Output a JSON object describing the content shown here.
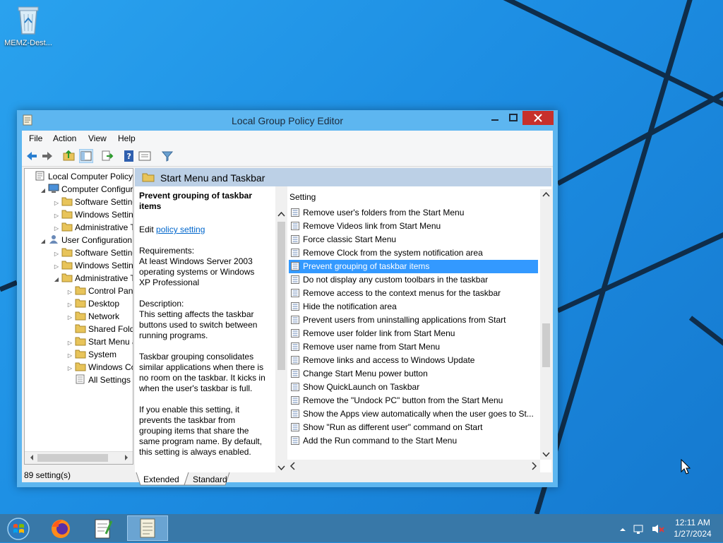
{
  "desktop": {
    "recycle_label": "MEMZ-Dest..."
  },
  "window": {
    "title": "Local Group Policy Editor",
    "menu": [
      "File",
      "Action",
      "View",
      "Help"
    ]
  },
  "tree": [
    {
      "label": "Local Computer Policy",
      "level": 0,
      "exp": ""
    },
    {
      "label": "Computer Configura",
      "level": 1,
      "exp": "open"
    },
    {
      "label": "Software Settings",
      "level": 2,
      "exp": "closed"
    },
    {
      "label": "Windows Setting",
      "level": 2,
      "exp": "closed"
    },
    {
      "label": "Administrative Te",
      "level": 2,
      "exp": "closed"
    },
    {
      "label": "User Configuration",
      "level": 1,
      "exp": "open"
    },
    {
      "label": "Software Settings",
      "level": 2,
      "exp": "closed"
    },
    {
      "label": "Windows Setting",
      "level": 2,
      "exp": "closed"
    },
    {
      "label": "Administrative Te",
      "level": 2,
      "exp": "open"
    },
    {
      "label": "Control Panel",
      "level": 3,
      "exp": "closed"
    },
    {
      "label": "Desktop",
      "level": 3,
      "exp": "closed"
    },
    {
      "label": "Network",
      "level": 3,
      "exp": "closed"
    },
    {
      "label": "Shared Folder",
      "level": 3,
      "exp": ""
    },
    {
      "label": "Start Menu ar",
      "level": 3,
      "exp": "closed"
    },
    {
      "label": "System",
      "level": 3,
      "exp": "closed"
    },
    {
      "label": "Windows Cor",
      "level": 3,
      "exp": "closed"
    },
    {
      "label": "All Settings",
      "level": 3,
      "exp": ""
    }
  ],
  "header": {
    "title": "Start Menu and Taskbar"
  },
  "description": {
    "title": "Prevent grouping of taskbar items",
    "edit_prefix": "Edit",
    "edit_link": "policy setting",
    "requirements_label": "Requirements:",
    "requirements": "At least Windows Server 2003 operating systems or Windows XP Professional",
    "description_label": "Description:",
    "para1": "This setting affects the taskbar buttons used to switch between running programs.",
    "para2": "Taskbar grouping consolidates similar applications when there is no room on the taskbar. It kicks in when the user's taskbar is full.",
    "para3": "If you enable this setting, it prevents the taskbar from grouping items that share the same program name. By default, this setting is always enabled."
  },
  "list": {
    "column": "Setting",
    "rows": [
      "Remove user's folders from the Start Menu",
      "Remove Videos link from Start Menu",
      "Force classic Start Menu",
      "Remove Clock from the system notification area",
      "Prevent grouping of taskbar items",
      "Do not display any custom toolbars in the taskbar",
      "Remove access to the context menus for the taskbar",
      "Hide the notification area",
      "Prevent users from uninstalling applications from Start",
      "Remove user folder link from Start Menu",
      "Remove user name from Start Menu",
      "Remove links and access to Windows Update",
      "Change Start Menu power button",
      "Show QuickLaunch on Taskbar",
      "Remove the \"Undock PC\" button from the Start Menu",
      "Show the Apps view automatically when the user goes to St...",
      "Show \"Run as different user\" command on Start",
      "Add the Run command to the Start Menu"
    ],
    "selected": 4
  },
  "tabs": [
    "Extended",
    "Standard"
  ],
  "status": "89 setting(s)",
  "tray": {
    "time": "12:11 AM",
    "date": "1/27/2024"
  },
  "colors": {
    "selection": "#3399ff",
    "close": "#c7302b",
    "taskbar": "#3878a8"
  }
}
